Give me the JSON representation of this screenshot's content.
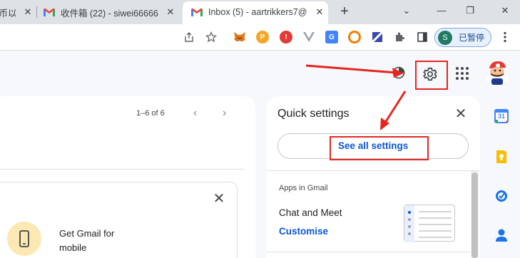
{
  "browser": {
    "tabs": [
      {
        "title": "市币以",
        "partial": true
      },
      {
        "title": "收件箱 (22) - siwei66666"
      },
      {
        "title": "Inbox (5) - aartrikkers7@",
        "active": true
      }
    ],
    "new_tab_label": "+",
    "profile_initial": "S",
    "profile_status": "已暂停",
    "window_controls": {
      "chevron": "⌄",
      "minimize": "—",
      "restore": "❐",
      "close": "✕"
    },
    "icons": [
      "share-icon",
      "star-icon",
      "metamask-icon",
      "pinterest-icon",
      "red-ext-icon",
      "vue-icon",
      "translate-icon",
      "orange-ring-icon",
      "diagonal-ext-icon",
      "puzzle-icon",
      "sidepanel-icon",
      "menu-icon"
    ]
  },
  "gmail": {
    "pager": {
      "range": "1–6 of 6",
      "prev": "‹",
      "next": "›"
    },
    "promo_card": {
      "text": "Get Gmail for mobile",
      "close": "✕"
    },
    "quick_settings": {
      "title": "Quick settings",
      "close": "✕",
      "see_all_label": "See all settings",
      "section_title": "Apps in Gmail",
      "chat_meet_label": "Chat and Meet",
      "customise_label": "Customise"
    },
    "side_apps": [
      "calendar-icon",
      "keep-icon",
      "tasks-icon",
      "contacts-icon"
    ],
    "calendar_day": "31",
    "annotation_color": "#e52620",
    "accent_color": "#0b57d0"
  }
}
